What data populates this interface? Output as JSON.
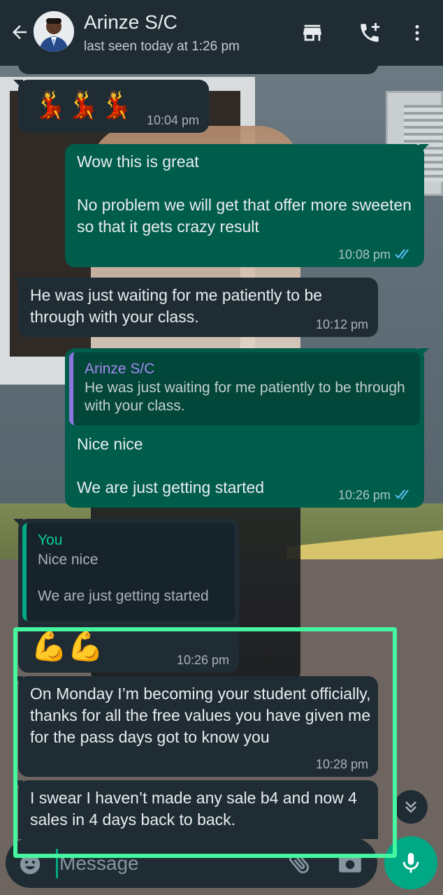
{
  "header": {
    "contact_name": "Arinze S/C",
    "status": "last seen today at 1:26 pm",
    "icons": [
      "back-arrow-icon",
      "store-icon",
      "add-call-icon",
      "more-vert-icon"
    ]
  },
  "messages": [
    {
      "direction": "in",
      "type": "emoji",
      "content": "💃💃💃",
      "time": "10:04 pm"
    },
    {
      "direction": "out",
      "text": "Wow this is great\n\nNo problem we will get that offer more sweeten so that it gets crazy result",
      "time": "10:08 pm",
      "read": true
    },
    {
      "direction": "in",
      "text": "He was just waiting for me patiently to be through with your class.",
      "time": "10:12 pm"
    },
    {
      "direction": "out",
      "quote": {
        "author": "Arinze S/C",
        "text": "He was just waiting for me patiently to be through with your class."
      },
      "text": "Nice nice\n\nWe are just getting started",
      "time": "10:26 pm",
      "read": true
    },
    {
      "direction": "in",
      "quote": {
        "author": "You",
        "text": "Nice nice\n\nWe are just getting started"
      },
      "emoji": "💪💪",
      "time": "10:26 pm"
    },
    {
      "direction": "in",
      "text": "On Monday I’m becoming your student officially, thanks for all the free values you have given me for the pass days got to know you",
      "time": "10:28 pm"
    },
    {
      "direction": "in",
      "text": "I swear I haven’t made any sale b4 and now 4 sales in 4 days back to back."
    }
  ],
  "composer": {
    "placeholder": "Message",
    "icons": [
      "emoji-icon",
      "attach-icon",
      "camera-icon",
      "mic-icon"
    ]
  },
  "colors": {
    "header_bg": "#1f2c34",
    "incoming_bubble": "#1f2c34",
    "outgoing_bubble": "#005c4b",
    "accent": "#00a884",
    "read_ticks": "#53bdeb",
    "highlight_frame": "#45f5a0"
  }
}
